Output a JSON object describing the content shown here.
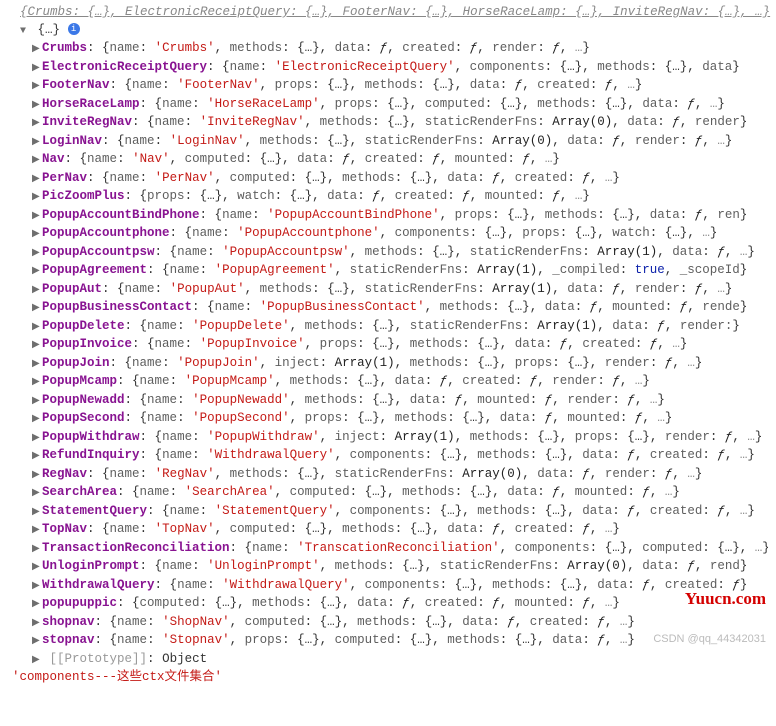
{
  "topSummary": "{Crumbs: {…}, ElectronicReceiptQuery: {…}, FooterNav: {…}, HorseRaceLamp: {…}, InviteRegNav: {…}, …}",
  "infoIcon": "i",
  "braceOpen": "{…}",
  "f": "ƒ",
  "dots": "…",
  "entries": [
    {
      "key": "Crumbs",
      "props": [
        [
          "name",
          "str",
          "'Crumbs'"
        ],
        [
          "methods",
          "obj"
        ],
        [
          "data",
          "f"
        ],
        [
          "created",
          "f"
        ],
        [
          "render",
          "f"
        ],
        [
          "…"
        ]
      ]
    },
    {
      "key": "ElectronicReceiptQuery",
      "props": [
        [
          "name",
          "str",
          "'ElectronicReceiptQuery'"
        ],
        [
          "components",
          "obj"
        ],
        [
          "methods",
          "obj"
        ],
        [
          "data",
          null,
          "…"
        ]
      ]
    },
    {
      "key": "FooterNav",
      "props": [
        [
          "name",
          "str",
          "'FooterNav'"
        ],
        [
          "props",
          "obj"
        ],
        [
          "methods",
          "obj"
        ],
        [
          "data",
          "f"
        ],
        [
          "created",
          "f"
        ],
        [
          "…"
        ]
      ]
    },
    {
      "key": "HorseRaceLamp",
      "props": [
        [
          "name",
          "str",
          "'HorseRaceLamp'"
        ],
        [
          "props",
          "obj"
        ],
        [
          "computed",
          "obj"
        ],
        [
          "methods",
          "obj"
        ],
        [
          "data",
          "f"
        ],
        [
          "…"
        ]
      ]
    },
    {
      "key": "InviteRegNav",
      "props": [
        [
          "name",
          "str",
          "'InviteRegNav'"
        ],
        [
          "methods",
          "obj"
        ],
        [
          "staticRenderFns",
          "arr",
          "Array(0)"
        ],
        [
          "data",
          "f"
        ],
        [
          "render",
          null,
          "…"
        ]
      ]
    },
    {
      "key": "LoginNav",
      "props": [
        [
          "name",
          "str",
          "'LoginNav'"
        ],
        [
          "methods",
          "obj"
        ],
        [
          "staticRenderFns",
          "arr",
          "Array(0)"
        ],
        [
          "data",
          "f"
        ],
        [
          "render",
          "f"
        ],
        [
          "…"
        ]
      ]
    },
    {
      "key": "Nav",
      "props": [
        [
          "name",
          "str",
          "'Nav'"
        ],
        [
          "computed",
          "obj"
        ],
        [
          "data",
          "f"
        ],
        [
          "created",
          "f"
        ],
        [
          "mounted",
          "f"
        ],
        [
          "…"
        ]
      ]
    },
    {
      "key": "PerNav",
      "props": [
        [
          "name",
          "str",
          "'PerNav'"
        ],
        [
          "computed",
          "obj"
        ],
        [
          "methods",
          "obj"
        ],
        [
          "data",
          "f"
        ],
        [
          "created",
          "f"
        ],
        [
          "…"
        ]
      ]
    },
    {
      "key": "PicZoomPlus",
      "props": [
        [
          "props",
          "obj"
        ],
        [
          "watch",
          "obj"
        ],
        [
          "data",
          "f"
        ],
        [
          "created",
          "f"
        ],
        [
          "mounted",
          "f"
        ],
        [
          "…"
        ]
      ]
    },
    {
      "key": "PopupAccountBindPhone",
      "props": [
        [
          "name",
          "str",
          "'PopupAccountBindPhone'"
        ],
        [
          "props",
          "obj"
        ],
        [
          "methods",
          "obj"
        ],
        [
          "data",
          "f"
        ],
        [
          "ren",
          null,
          "…"
        ]
      ]
    },
    {
      "key": "PopupAccountphone",
      "props": [
        [
          "name",
          "str",
          "'PopupAccountphone'"
        ],
        [
          "components",
          "obj"
        ],
        [
          "props",
          "obj"
        ],
        [
          "watch",
          "obj"
        ],
        [
          "…"
        ]
      ]
    },
    {
      "key": "PopupAccountpsw",
      "props": [
        [
          "name",
          "str",
          "'PopupAccountpsw'"
        ],
        [
          "methods",
          "obj"
        ],
        [
          "staticRenderFns",
          "arr",
          "Array(1)"
        ],
        [
          "data",
          "f"
        ],
        [
          "…"
        ]
      ]
    },
    {
      "key": "PopupAgreement",
      "props": [
        [
          "name",
          "str",
          "'PopupAgreement'"
        ],
        [
          "staticRenderFns",
          "arr",
          "Array(1)"
        ],
        [
          "_compiled",
          "bool",
          "true"
        ],
        [
          "_scopeId",
          null,
          "…"
        ]
      ]
    },
    {
      "key": "PopupAut",
      "props": [
        [
          "name",
          "str",
          "'PopupAut'"
        ],
        [
          "methods",
          "obj"
        ],
        [
          "staticRenderFns",
          "arr",
          "Array(1)"
        ],
        [
          "data",
          "f"
        ],
        [
          "render",
          "f"
        ],
        [
          "…"
        ]
      ]
    },
    {
      "key": "PopupBusinessContact",
      "props": [
        [
          "name",
          "str",
          "'PopupBusinessContact'"
        ],
        [
          "methods",
          "obj"
        ],
        [
          "data",
          "f"
        ],
        [
          "mounted",
          "f"
        ],
        [
          "rende",
          null,
          "…"
        ]
      ]
    },
    {
      "key": "PopupDelete",
      "props": [
        [
          "name",
          "str",
          "'PopupDelete'"
        ],
        [
          "methods",
          "obj"
        ],
        [
          "staticRenderFns",
          "arr",
          "Array(1)"
        ],
        [
          "data",
          "f"
        ],
        [
          "render:",
          null,
          "…"
        ]
      ]
    },
    {
      "key": "PopupInvoice",
      "props": [
        [
          "name",
          "str",
          "'PopupInvoice'"
        ],
        [
          "props",
          "obj"
        ],
        [
          "methods",
          "obj"
        ],
        [
          "data",
          "f"
        ],
        [
          "created",
          "f"
        ],
        [
          "…"
        ]
      ]
    },
    {
      "key": "PopupJoin",
      "props": [
        [
          "name",
          "str",
          "'PopupJoin'"
        ],
        [
          "inject",
          "arr",
          "Array(1)"
        ],
        [
          "methods",
          "obj"
        ],
        [
          "props",
          "obj"
        ],
        [
          "render",
          "f"
        ],
        [
          "…"
        ]
      ]
    },
    {
      "key": "PopupMcamp",
      "props": [
        [
          "name",
          "str",
          "'PopupMcamp'"
        ],
        [
          "methods",
          "obj"
        ],
        [
          "data",
          "f"
        ],
        [
          "created",
          "f"
        ],
        [
          "render",
          "f"
        ],
        [
          "…"
        ]
      ]
    },
    {
      "key": "PopupNewadd",
      "props": [
        [
          "name",
          "str",
          "'PopupNewadd'"
        ],
        [
          "methods",
          "obj"
        ],
        [
          "data",
          "f"
        ],
        [
          "mounted",
          "f"
        ],
        [
          "render",
          "f"
        ],
        [
          "…"
        ]
      ]
    },
    {
      "key": "PopupSecond",
      "props": [
        [
          "name",
          "str",
          "'PopupSecond'"
        ],
        [
          "props",
          "obj"
        ],
        [
          "methods",
          "obj"
        ],
        [
          "data",
          "f"
        ],
        [
          "mounted",
          "f"
        ],
        [
          "…"
        ]
      ]
    },
    {
      "key": "PopupWithdraw",
      "props": [
        [
          "name",
          "str",
          "'PopupWithdraw'"
        ],
        [
          "inject",
          "arr",
          "Array(1)"
        ],
        [
          "methods",
          "obj"
        ],
        [
          "props",
          "obj"
        ],
        [
          "render",
          "f"
        ],
        [
          "…"
        ]
      ]
    },
    {
      "key": "RefundInquiry",
      "props": [
        [
          "name",
          "str",
          "'WithdrawalQuery'"
        ],
        [
          "components",
          "obj"
        ],
        [
          "methods",
          "obj"
        ],
        [
          "data",
          "f"
        ],
        [
          "created",
          "f"
        ],
        [
          "…"
        ]
      ]
    },
    {
      "key": "RegNav",
      "props": [
        [
          "name",
          "str",
          "'RegNav'"
        ],
        [
          "methods",
          "obj"
        ],
        [
          "staticRenderFns",
          "arr",
          "Array(0)"
        ],
        [
          "data",
          "f"
        ],
        [
          "render",
          "f"
        ],
        [
          "…"
        ]
      ]
    },
    {
      "key": "SearchArea",
      "props": [
        [
          "name",
          "str",
          "'SearchArea'"
        ],
        [
          "computed",
          "obj"
        ],
        [
          "methods",
          "obj"
        ],
        [
          "data",
          "f"
        ],
        [
          "mounted",
          "f"
        ],
        [
          "…"
        ]
      ]
    },
    {
      "key": "StatementQuery",
      "props": [
        [
          "name",
          "str",
          "'StatementQuery'"
        ],
        [
          "components",
          "obj"
        ],
        [
          "methods",
          "obj"
        ],
        [
          "data",
          "f"
        ],
        [
          "created",
          "f"
        ],
        [
          "…"
        ]
      ]
    },
    {
      "key": "TopNav",
      "props": [
        [
          "name",
          "str",
          "'TopNav'"
        ],
        [
          "computed",
          "obj"
        ],
        [
          "methods",
          "obj"
        ],
        [
          "data",
          "f"
        ],
        [
          "created",
          "f"
        ],
        [
          "…"
        ]
      ]
    },
    {
      "key": "TransactionReconciliation",
      "props": [
        [
          "name",
          "str",
          "'TranscationReconciliation'"
        ],
        [
          "components",
          "obj"
        ],
        [
          "computed",
          "obj"
        ],
        [
          "…"
        ]
      ]
    },
    {
      "key": "UnloginPrompt",
      "props": [
        [
          "name",
          "str",
          "'UnloginPrompt'"
        ],
        [
          "methods",
          "obj"
        ],
        [
          "staticRenderFns",
          "arr",
          "Array(0)"
        ],
        [
          "data",
          "f"
        ],
        [
          "rend",
          null,
          "…"
        ]
      ]
    },
    {
      "key": "WithdrawalQuery",
      "props": [
        [
          "name",
          "str",
          "'WithdrawalQuery'"
        ],
        [
          "components",
          "obj"
        ],
        [
          "methods",
          "obj"
        ],
        [
          "data",
          "f"
        ],
        [
          "created",
          "f",
          null,
          "…"
        ]
      ]
    },
    {
      "key": "popupuppic",
      "props": [
        [
          "computed",
          "obj"
        ],
        [
          "methods",
          "obj"
        ],
        [
          "data",
          "f"
        ],
        [
          "created",
          "f"
        ],
        [
          "mounted",
          "f"
        ],
        [
          "…"
        ]
      ]
    },
    {
      "key": "shopnav",
      "props": [
        [
          "name",
          "str",
          "'ShopNav'"
        ],
        [
          "computed",
          "obj"
        ],
        [
          "methods",
          "obj"
        ],
        [
          "data",
          "f"
        ],
        [
          "created",
          "f"
        ],
        [
          "…"
        ]
      ]
    },
    {
      "key": "stopnav",
      "props": [
        [
          "name",
          "str",
          "'Stopnav'"
        ],
        [
          "props",
          "obj"
        ],
        [
          "computed",
          "obj"
        ],
        [
          "methods",
          "obj"
        ],
        [
          "data",
          "f"
        ],
        [
          "…"
        ]
      ]
    }
  ],
  "proto": {
    "key": "[[Prototype]]",
    "value": "Object"
  },
  "bottomLine": "'components---这些ctx文件集合'",
  "watermark1": "Yuucn.com",
  "watermark2": "CSDN @qq_44342031"
}
